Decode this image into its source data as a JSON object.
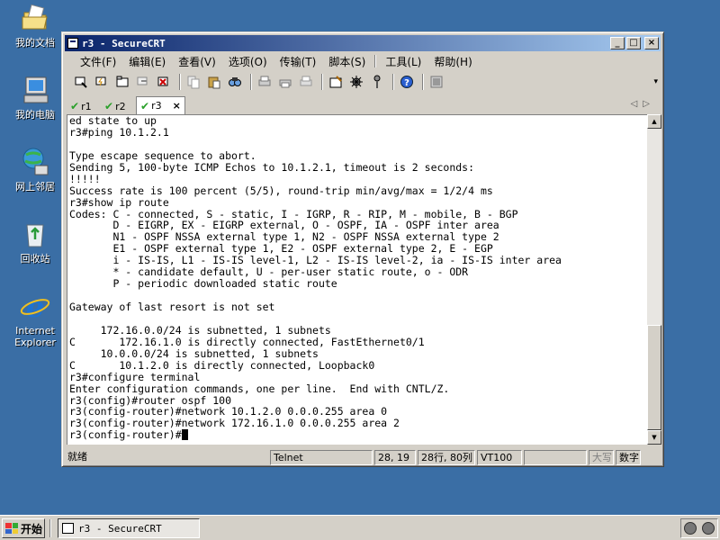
{
  "desktop": {
    "icons": [
      {
        "label": "我的文档",
        "icon": "folder-documents-icon"
      },
      {
        "label": "我的电脑",
        "icon": "computer-icon"
      },
      {
        "label": "网上邻居",
        "icon": "network-icon"
      },
      {
        "label": "回收站",
        "icon": "recycle-bin-icon"
      },
      {
        "label": "Internet Explorer",
        "icon": "internet-explorer-icon"
      }
    ]
  },
  "window": {
    "title": "r3 - SecureCRT",
    "controls": {
      "minimize": "_",
      "maximize": "□",
      "close": "×"
    }
  },
  "menu": [
    "文件(F)",
    "编辑(E)",
    "查看(V)",
    "选项(O)",
    "传输(T)",
    "脚本(S)",
    "工具(L)",
    "帮助(H)"
  ],
  "toolbar": [
    "connect-icon",
    "quick-connect-icon",
    "connect-tab-icon",
    "reconnect-icon",
    "disconnect-icon",
    "copy-icon",
    "paste-icon",
    "find-icon",
    "print-icon",
    "print-setup-icon",
    "print-preview-icon",
    "session-options-icon",
    "global-options-icon",
    "keymap-icon",
    "help-icon",
    "sftp-icon"
  ],
  "tabs": [
    {
      "label": "r1",
      "active": false
    },
    {
      "label": "r2",
      "active": false
    },
    {
      "label": "r3",
      "active": true,
      "close": "×"
    }
  ],
  "terminal": {
    "lines": [
      "ed state to up",
      "r3#ping 10.1.2.1",
      "",
      "Type escape sequence to abort.",
      "Sending 5, 100-byte ICMP Echos to 10.1.2.1, timeout is 2 seconds:",
      "!!!!!",
      "Success rate is 100 percent (5/5), round-trip min/avg/max = 1/2/4 ms",
      "r3#show ip route",
      "Codes: C - connected, S - static, I - IGRP, R - RIP, M - mobile, B - BGP",
      "       D - EIGRP, EX - EIGRP external, O - OSPF, IA - OSPF inter area",
      "       N1 - OSPF NSSA external type 1, N2 - OSPF NSSA external type 2",
      "       E1 - OSPF external type 1, E2 - OSPF external type 2, E - EGP",
      "       i - IS-IS, L1 - IS-IS level-1, L2 - IS-IS level-2, ia - IS-IS inter area",
      "       * - candidate default, U - per-user static route, o - ODR",
      "       P - periodic downloaded static route",
      "",
      "Gateway of last resort is not set",
      "",
      "     172.16.0.0/24 is subnetted, 1 subnets",
      "C       172.16.1.0 is directly connected, FastEthernet0/1",
      "     10.0.0.0/24 is subnetted, 1 subnets",
      "C       10.1.2.0 is directly connected, Loopback0",
      "r3#configure terminal",
      "Enter configuration commands, one per line.  End with CNTL/Z.",
      "r3(config)#router ospf 100",
      "r3(config-router)#network 10.1.2.0 0.0.0.255 area 0",
      "r3(config-router)#network 172.16.1.0 0.0.0.255 area 2",
      "r3(config-router)#"
    ]
  },
  "status": {
    "ready": "就绪",
    "protocol": "Telnet",
    "cursor_pos": "28, 19",
    "rows_cols": "28行, 80列",
    "emulation": "VT100",
    "caps": "大写",
    "num": "数字"
  },
  "taskbar": {
    "start": "开始",
    "task": "r3 - SecureCRT"
  }
}
